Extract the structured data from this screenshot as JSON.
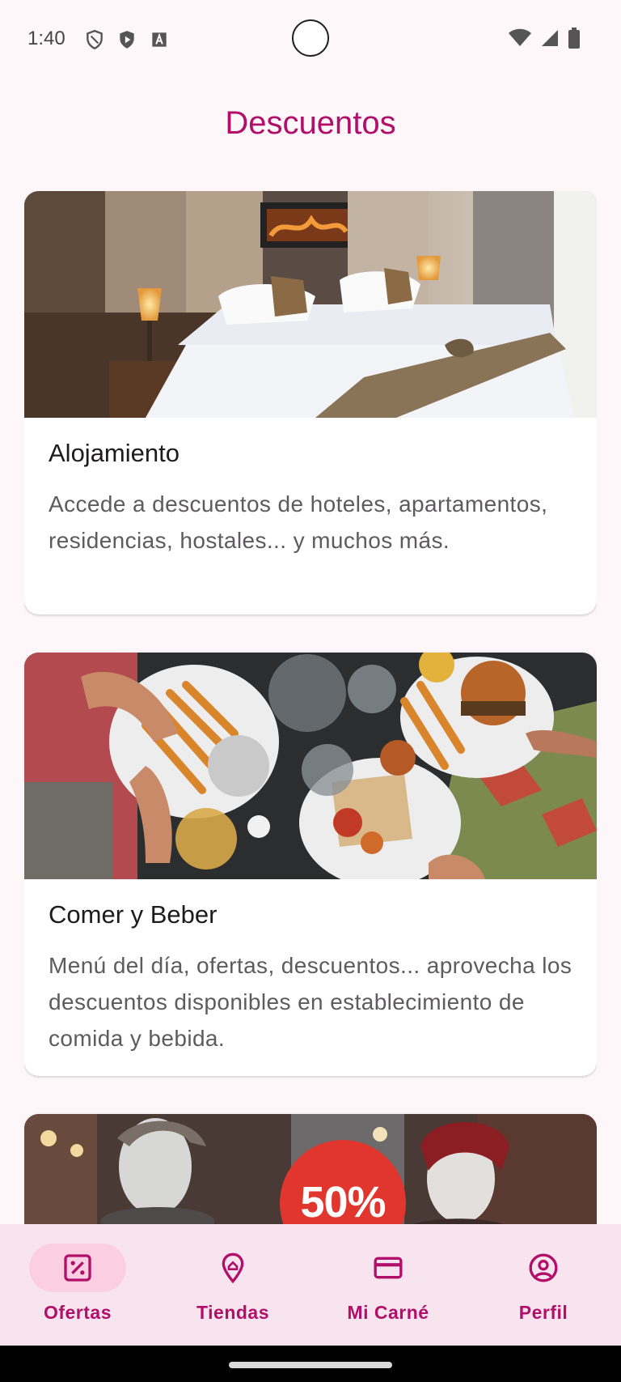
{
  "status_bar": {
    "time": "1:40"
  },
  "page": {
    "title": "Descuentos"
  },
  "cards": [
    {
      "title": "Alojamiento",
      "description": "Accede a descuentos de hoteles, apartamentos, residencias, hostales... y muchos más.",
      "image_icon": "hotel-room-photo"
    },
    {
      "title": "Comer y Beber",
      "description": "Menú del día, ofertas, descuentos... aprovecha los descuentos disponibles en establecimiento de comida y bebida.",
      "image_icon": "restaurant-table-photo"
    },
    {
      "title": "",
      "description": "",
      "image_text": "50%",
      "image_icon": "fashion-store-photo"
    }
  ],
  "bottom_nav": {
    "items": [
      {
        "label": "Ofertas",
        "icon": "discount-icon",
        "active": true
      },
      {
        "label": "Tiendas",
        "icon": "location-pin-icon",
        "active": false
      },
      {
        "label": "Mi Carné",
        "icon": "card-icon",
        "active": false
      },
      {
        "label": "Perfil",
        "icon": "profile-icon",
        "active": false
      }
    ]
  },
  "colors": {
    "brand": "#b10f6a",
    "background": "#fdf7fa",
    "nav_background": "#f8e4ee",
    "active_pill": "#fbcfe1"
  }
}
